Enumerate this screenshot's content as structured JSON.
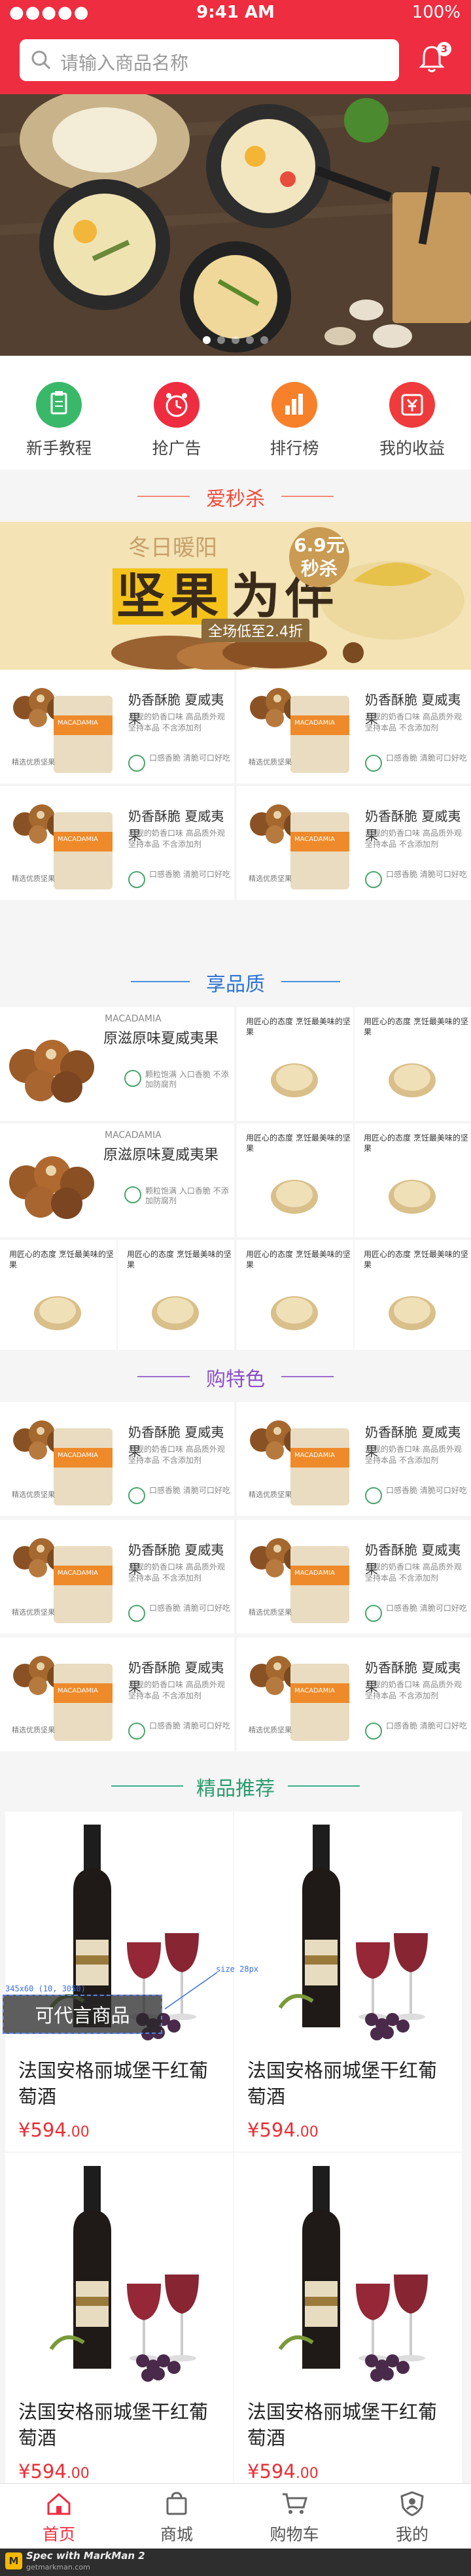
{
  "status": {
    "signal": "●●●●●",
    "time": "9:41 AM",
    "battery": "100%"
  },
  "header": {
    "search_placeholder": "请输入商品名称",
    "badge": "3"
  },
  "quick_nav": [
    {
      "label": "新手教程",
      "color": "#3ab86a"
    },
    {
      "label": "抢广告",
      "color": "#ef2d40"
    },
    {
      "label": "排行榜",
      "color": "#f7802b"
    },
    {
      "label": "我的收益",
      "color": "#ef3b3b"
    }
  ],
  "sections": {
    "flash": "爱秒杀",
    "enjoy": "享品质",
    "special": "购特色",
    "recommend": "精品推荐"
  },
  "promo": {
    "line1": "冬日暖阳",
    "line2a": "坚果",
    "line2b": "为伴",
    "line3": "全场低至2.4折",
    "medal1": "6.9元",
    "medal2": "秒杀"
  },
  "nut_card": {
    "name": "奶香酥脆 夏威夷果",
    "desc": "济规的奶香口味 高品质外观坚持本品 不含添加剂",
    "badge": "口感香脆 清脆可口好吃",
    "bag_label": "MACADAMIA",
    "promise": "精选优质坚果"
  },
  "big_card": {
    "en": "MACADAMIA",
    "cn": "原滋原味夏威夷果",
    "tx": "颗粒饱满 入口香脆 不添加防腐剂"
  },
  "small_card": {
    "h": "用匠心的态度 烹饪最美味的坚果"
  },
  "wine": {
    "name": "法国安格丽城堡干红葡萄酒",
    "price_int": "¥594",
    "price_dec": ".00",
    "overlay": "可代言商品",
    "ann_size": "345x60 (10, 3050)",
    "ann_font": "size 28px"
  },
  "tabs": [
    {
      "label": "首页",
      "color": "#ef2d40"
    },
    {
      "label": "商城",
      "color": "#555555"
    },
    {
      "label": "购物车",
      "color": "#555555"
    },
    {
      "label": "我的",
      "color": "#555555"
    }
  ],
  "footer": {
    "brand": "Spec with MarkMan 2",
    "url": "getmarkman.com",
    "logo": "M"
  }
}
